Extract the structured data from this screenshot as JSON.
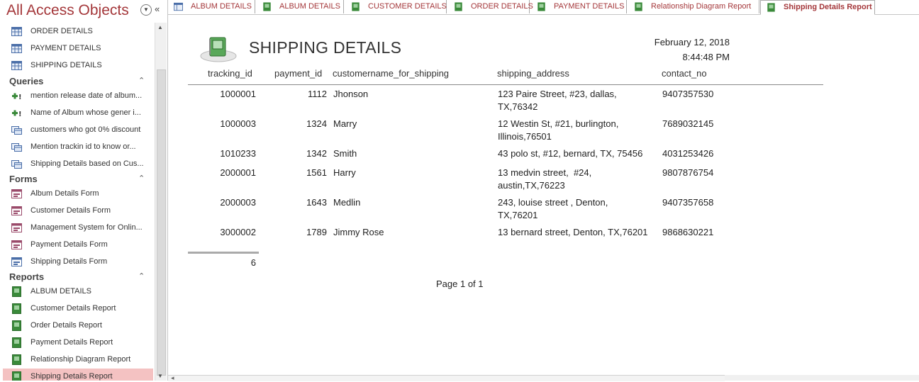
{
  "nav": {
    "title": "All Access Objects",
    "tables": [
      {
        "label": "ORDER DETAILS",
        "icon": "table-icon"
      },
      {
        "label": "PAYMENT DETAILS",
        "icon": "table-icon"
      },
      {
        "label": "SHIPPING DETAILS",
        "icon": "table-icon"
      }
    ],
    "queries_label": "Queries",
    "queries": [
      {
        "label": "mention release date of album...",
        "icon": "append-query-icon"
      },
      {
        "label": "Name of Album whose gener i...",
        "icon": "append-query-icon"
      },
      {
        "label": "customers who got 0% discount",
        "icon": "select-query-icon"
      },
      {
        "label": "Mention trackin id to know or...",
        "icon": "select-query-icon"
      },
      {
        "label": "Shipping Details based on Cus...",
        "icon": "select-query-icon"
      }
    ],
    "forms_label": "Forms",
    "forms": [
      {
        "label": "Album Details Form",
        "icon": "form-icon"
      },
      {
        "label": "Customer Details Form",
        "icon": "form-icon"
      },
      {
        "label": "Management System for Onlin...",
        "icon": "form-icon"
      },
      {
        "label": "Payment Details Form",
        "icon": "form-icon"
      },
      {
        "label": "Shipping Details Form",
        "icon": "form-icon"
      }
    ],
    "reports_label": "Reports",
    "reports": [
      {
        "label": "ALBUM DETAILS",
        "icon": "report-icon"
      },
      {
        "label": "Customer Details Report",
        "icon": "report-icon"
      },
      {
        "label": "Order Details Report",
        "icon": "report-icon"
      },
      {
        "label": "Payment Details Report",
        "icon": "report-icon"
      },
      {
        "label": "Relationship Diagram Report",
        "icon": "report-icon"
      },
      {
        "label": "Shipping Details Report",
        "icon": "report-icon",
        "selected": true
      }
    ]
  },
  "tabs": [
    {
      "label": "ALBUM DETAILS",
      "icon": "table-icon"
    },
    {
      "label": "ALBUM DETAILS",
      "icon": "report-icon"
    },
    {
      "label": "CUSTOMER DETAILS",
      "icon": "report-icon"
    },
    {
      "label": "ORDER DETAILS",
      "icon": "report-icon"
    },
    {
      "label": "PAYMENT DETAILS",
      "icon": "report-icon"
    },
    {
      "label": "Relationship Diagram Report",
      "icon": "report-icon"
    },
    {
      "label": "Shipping Details Report",
      "icon": "report-icon",
      "active": true
    }
  ],
  "report": {
    "title": "SHIPPING DETAILS",
    "date": "February 12, 2018",
    "time": "8:44:48 PM",
    "columns": {
      "tracking_id": "tracking_id",
      "payment_id": "payment_id",
      "customername": "customername_for_shipping",
      "address": "shipping_address",
      "contact": "contact_no"
    },
    "rows": [
      {
        "tracking_id": "1000001",
        "payment_id": "1112",
        "customername": "Jhonson",
        "address1": "123 Paire Street, #23, dallas,",
        "address2": "TX,76342",
        "contact": "9407357530"
      },
      {
        "tracking_id": "1000003",
        "payment_id": "1324",
        "customername": "Marry",
        "address1": "12 Westin St, #21, burlington,",
        "address2": "Illinois,76501",
        "contact": "7689032145"
      },
      {
        "tracking_id": "1010233",
        "payment_id": "1342",
        "customername": "Smith",
        "address1": "43 polo st, #12, bernard, TX, 75456",
        "address2": "",
        "contact": "4031253426"
      },
      {
        "tracking_id": "2000001",
        "payment_id": "1561",
        "customername": "Harry",
        "address1": "13 medvin street,  #24,",
        "address2": "austin,TX,76223",
        "contact": "9807876754"
      },
      {
        "tracking_id": "2000003",
        "payment_id": "1643",
        "customername": "Medlin",
        "address1": "243, louise street , Denton,",
        "address2": "TX,76201",
        "contact": "9407357658"
      },
      {
        "tracking_id": "3000002",
        "payment_id": "1789",
        "customername": "Jimmy Rose",
        "address1": "13 bernard street, Denton, TX,76201",
        "address2": "",
        "contact": "9868630221"
      }
    ],
    "count": "6",
    "page": "Page 1 of 1"
  },
  "colors": {
    "accent": "#a4373a",
    "selected_bg": "#f4c2c2",
    "report_icon_green": "#3a8a3a"
  }
}
